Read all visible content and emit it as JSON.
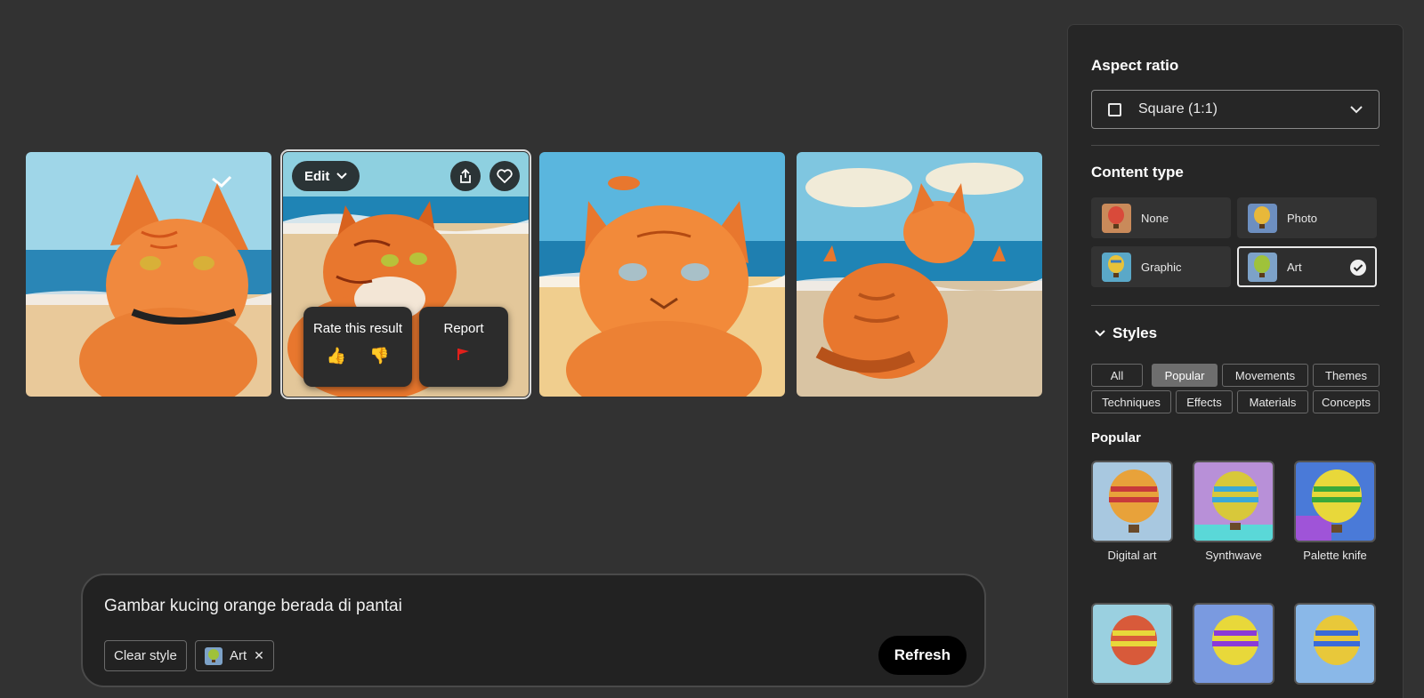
{
  "images": [
    {
      "name": "cat-image-1"
    },
    {
      "name": "cat-image-2"
    },
    {
      "name": "cat-image-3"
    },
    {
      "name": "cat-image-4"
    }
  ],
  "overlay": {
    "edit_label": "Edit",
    "rate_title": "Rate this result",
    "report_title": "Report",
    "icons": [
      "chevron-down-icon",
      "share-icon",
      "heart-icon",
      "thumbs-up-icon",
      "thumbs-down-icon",
      "flag-icon"
    ]
  },
  "prompt": {
    "text": "Gambar kucing orange berada di pantai",
    "clear_style_label": "Clear style",
    "style_chip_label": "Art",
    "refresh_label": "Refresh"
  },
  "panel": {
    "aspect_title": "Aspect ratio",
    "aspect_value": "Square (1:1)",
    "content_title": "Content type",
    "content_types": [
      {
        "label": "None",
        "selected": false
      },
      {
        "label": "Photo",
        "selected": false
      },
      {
        "label": "Graphic",
        "selected": false
      },
      {
        "label": "Art",
        "selected": true
      }
    ],
    "styles_title": "Styles",
    "style_tabs": [
      "All",
      "Popular",
      "Movements",
      "Themes",
      "Techniques",
      "Effects",
      "Materials",
      "Concepts"
    ],
    "active_tab": "Popular",
    "popular_title": "Popular",
    "popular_items": [
      "Digital art",
      "Synthwave",
      "Palette knife"
    ]
  },
  "colors": {
    "background": "#323232",
    "panel": "#262626",
    "cat_orange": "#e8772e",
    "sky": "#7fc6e0",
    "sea": "#2a86b6",
    "sand": "#e9c99a",
    "flag_red": "#e0201b"
  }
}
